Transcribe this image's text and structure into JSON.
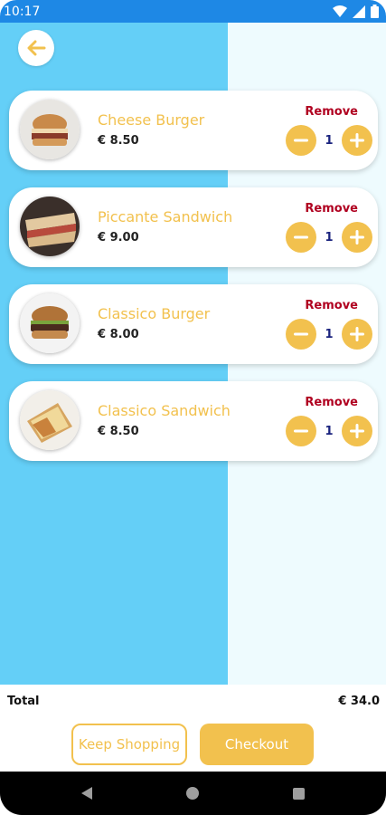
{
  "status_bar": {
    "time": "10:17",
    "icons": [
      "wifi-icon",
      "signal-icon",
      "battery-icon"
    ]
  },
  "colors": {
    "accent": "#f2c14e",
    "remove": "#b00020",
    "left_panel": "#64cff7",
    "right_panel": "#eefbfe",
    "status_bar": "#1e88e5"
  },
  "cart": {
    "remove_label": "Remove",
    "items": [
      {
        "name": "Cheese Burger",
        "price": "€ 8.50",
        "quantity": "1",
        "image": "cheese-burger-image"
      },
      {
        "name": "Piccante Sandwich",
        "price": "€ 9.00",
        "quantity": "1",
        "image": "piccante-sandwich-image"
      },
      {
        "name": "Classico Burger",
        "price": "€ 8.00",
        "quantity": "1",
        "image": "classico-burger-image"
      },
      {
        "name": "Classico Sandwich",
        "price": "€ 8.50",
        "quantity": "1",
        "image": "classico-sandwich-image"
      }
    ]
  },
  "footer": {
    "total_label": "Total",
    "total_value": "€ 34.0",
    "keep_shopping_label": "Keep Shopping",
    "checkout_label": "Checkout"
  }
}
